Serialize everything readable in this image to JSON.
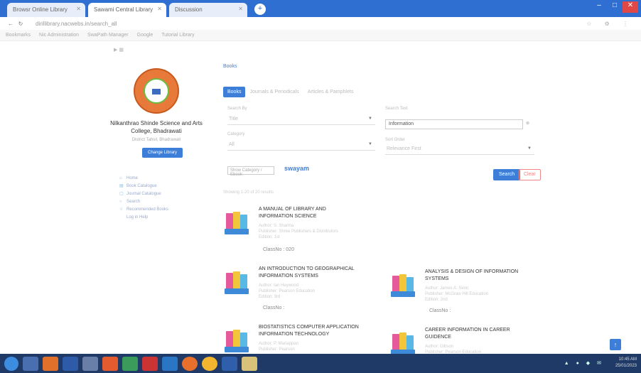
{
  "browser": {
    "tabs": [
      {
        "label": "Browsr Online Library"
      },
      {
        "label": "Sawami Central Library"
      },
      {
        "label": "Discussion"
      }
    ],
    "url": "dirillibrary.nacwebs.in/search_all",
    "bookmarks": [
      "Bookmarks",
      "Nic Administration",
      "SwaPath Manager",
      "Google",
      "Tutorial Library"
    ]
  },
  "sidebar": {
    "college_name_line1": "Nilkanthrao Shinde Science and Arts",
    "college_name_line2": "College, Bhadrawati",
    "location": "District Tahsil, Bhadrawati",
    "change_library_label": "Change Library",
    "nav": [
      {
        "icon": "home-icon",
        "label": "Home"
      },
      {
        "icon": "book-icon",
        "label": "Book Catalogue"
      },
      {
        "icon": "journal-icon",
        "label": "Journal Catalogue"
      },
      {
        "icon": "search-icon",
        "label": "Search"
      },
      {
        "icon": "star-icon",
        "label": "Recommended Books"
      },
      {
        "icon": "",
        "label": "Log in Help"
      }
    ]
  },
  "main": {
    "breadcrumb": "Books",
    "tabs": [
      {
        "label": "Books",
        "active": true
      },
      {
        "label": "Journals & Periodicals"
      },
      {
        "label": "Articles & Pamphlets"
      }
    ],
    "fields": {
      "search_by_label": "Search By",
      "search_by_value": "Title",
      "search_text_label": "Search Text",
      "search_text_value": "Information",
      "category_label": "Category",
      "category_value": "All",
      "sort_label": "Sort Order",
      "sort_value": "Relevance First"
    },
    "swayam_dropdown": "Show Category / Ebook",
    "swayam_label": "swayam",
    "search_label": "Search",
    "clear_label": "Clear",
    "results_count": "Showing 1-20 of 20 results",
    "results": [
      {
        "title_l1": "A MANUAL OF LIBRARY AND",
        "title_l2": "INFORMATION SCIENCE",
        "meta1": "Author: S. Sharma",
        "meta2": "Publisher: Shree Publishers & Distributors",
        "meta3": "Edition: 1st",
        "classno": "ClassNo : 020"
      },
      {
        "title_l1": "AN INTRODUCTION TO GEOGRAPHICAL",
        "title_l2": "INFORMATION SYSTEMS",
        "meta1": "Author: Ian Heywood",
        "meta2": "Publisher: Pearson Education",
        "meta3": "Edition: 3rd",
        "classno": "ClassNo :"
      },
      {
        "title_l1": "ANALYSIS & DESIGN OF INFORMATION",
        "title_l2": "SYSTEMS",
        "meta1": "Author: James A. Senn",
        "meta2": "Publisher: McGraw Hill Education",
        "meta3": "Edition: 2nd",
        "classno": "ClassNo :"
      },
      {
        "title_l1": "BIOSTATISTICS COMPUTER APPLICATION",
        "title_l2": "INFORMATION TECHNOLOGY",
        "meta1": "Author: P. Mariappan",
        "meta2": "Publisher: Pearson",
        "meta3": "",
        "classno": ""
      },
      {
        "title_l1": "CAREER INFORMATION IN CAREER",
        "title_l2": "GUIDENCE",
        "meta1": "Author: Gibson",
        "meta2": "Publisher: Pearson Education",
        "meta3": "",
        "classno": ""
      }
    ]
  },
  "taskbar": {
    "time": "10:45 AM",
    "date": "25/01/2023"
  },
  "colors": {
    "accent": "#3d7ed8",
    "tabbar": "#2f6fd1",
    "taskbar": "#1f3a66",
    "logo": "#e7793a"
  }
}
